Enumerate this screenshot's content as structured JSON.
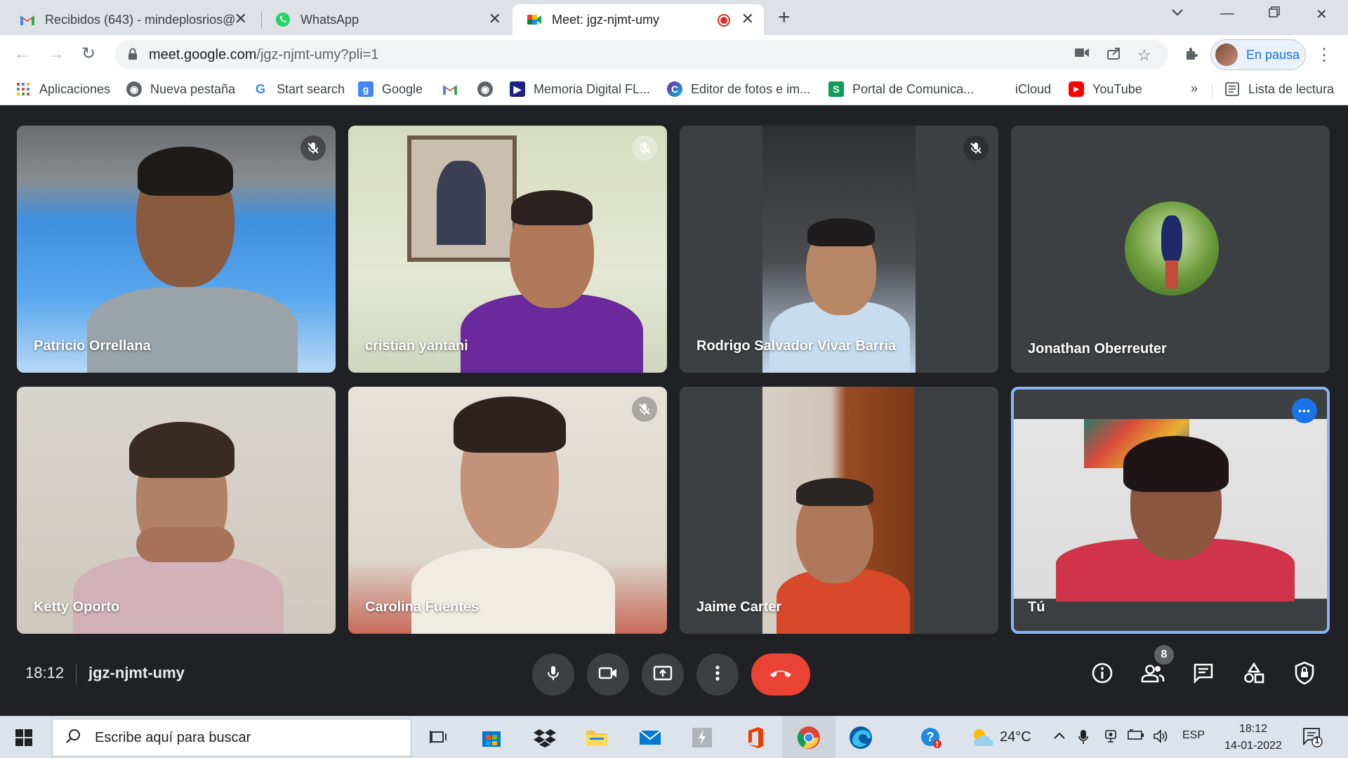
{
  "browser": {
    "tabs": [
      {
        "title": "Recibidos (643) - mindeplosrios@",
        "active": false
      },
      {
        "title": "WhatsApp",
        "active": false
      },
      {
        "title": "Meet: jgz-njmt-umy",
        "active": true
      }
    ],
    "url_host": "meet.google.com",
    "url_path": "/jgz-njmt-umy?pli=1",
    "profile_label": "En pausa",
    "bookmarks": [
      {
        "label": "Aplicaciones",
        "icon": "apps-grid-icon"
      },
      {
        "label": "Nueva pestaña",
        "icon": "globe-icon"
      },
      {
        "label": "Start search",
        "icon": "google-g-icon"
      },
      {
        "label": "Google",
        "icon": "google-icon"
      },
      {
        "label": "",
        "icon": "gmail-icon"
      },
      {
        "label": "",
        "icon": "globe-icon"
      },
      {
        "label": "Memoria Digital FL...",
        "icon": "bookmark-flag-icon"
      },
      {
        "label": "Editor de fotos e im...",
        "icon": "photo-editor-icon"
      },
      {
        "label": "Portal de Comunica...",
        "icon": "portal-icon"
      },
      {
        "label": "iCloud",
        "icon": "apple-icon"
      },
      {
        "label": "YouTube",
        "icon": "youtube-icon"
      }
    ],
    "reading_list": "Lista de lectura",
    "more_bookmarks": "»"
  },
  "meet": {
    "participants": [
      {
        "name": "Patricio Orrellana",
        "muted": true
      },
      {
        "name": "cristian yantani",
        "muted": true
      },
      {
        "name": "Rodrigo Salvador Vivar Barria",
        "muted": true
      },
      {
        "name": "Jonathan Oberreuter",
        "muted": false
      },
      {
        "name": "Ketty Oporto",
        "muted": false
      },
      {
        "name": "Carolina Fuentes",
        "muted": true
      },
      {
        "name": "Jaime Carter",
        "muted": false
      },
      {
        "name": "Tú",
        "muted": false
      }
    ],
    "time": "18:12",
    "meeting_code": "jgz-njmt-umy",
    "participant_count": "8",
    "self_more": "•••"
  },
  "taskbar": {
    "search_placeholder": "Escribe aquí para buscar",
    "weather": "24°C",
    "language": "ESP",
    "clock_time": "18:12",
    "clock_date": "14-01-2022",
    "notification_count": "1"
  },
  "colors": {
    "meet_bg": "#202124",
    "tile_bg": "#3c4043",
    "hangup": "#ea4335",
    "accent_blue": "#1a73e8",
    "self_border": "#8ab4f8"
  }
}
